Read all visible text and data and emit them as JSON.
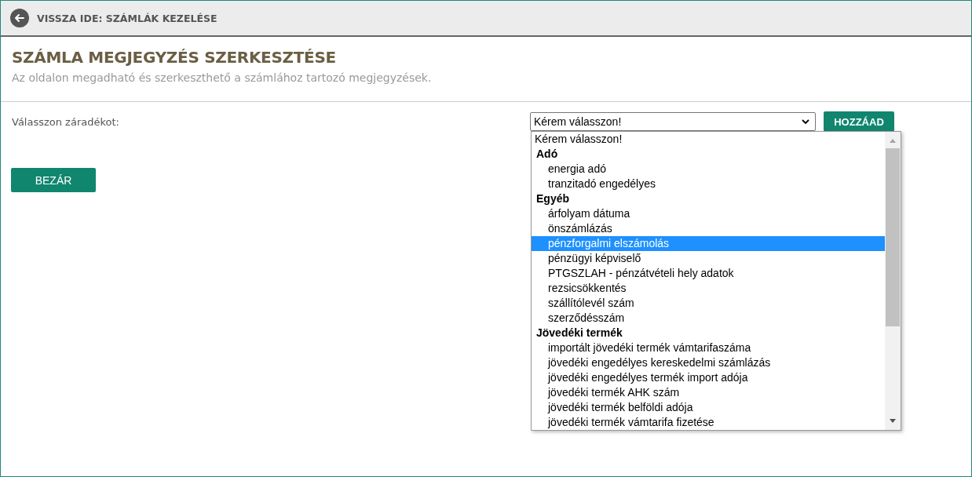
{
  "header": {
    "back_link": "VISSZA IDE: SZÁMLÁK KEZELÉSE"
  },
  "page": {
    "title": "SZÁMLA MEGJEGYZÉS SZERKESZTÉSE",
    "subtitle": "Az oldalon megadható és szerkeszthető a számlához tartozó megjegyzések."
  },
  "form": {
    "label": "Válasszon záradékot:",
    "select_value": "Kérem válasszon!",
    "add_button": "HOZZÁAD",
    "close_button": "BEZÁR"
  },
  "dropdown": {
    "items": [
      {
        "kind": "option",
        "label": "Kérem válasszon!",
        "selected": false
      },
      {
        "kind": "group",
        "label": "Adó",
        "children": [
          {
            "label": "energia adó",
            "selected": false
          },
          {
            "label": "tranzitadó engedélyes",
            "selected": false
          }
        ]
      },
      {
        "kind": "group",
        "label": "Egyéb",
        "children": [
          {
            "label": "árfolyam dátuma",
            "selected": false
          },
          {
            "label": "önszámlázás",
            "selected": false
          },
          {
            "label": "pénzforgalmi elszámolás",
            "selected": true
          },
          {
            "label": "pénzügyi képviselő",
            "selected": false
          },
          {
            "label": "PTGSZLAH - pénzátvételi hely adatok",
            "selected": false
          },
          {
            "label": "rezsicsökkentés",
            "selected": false
          },
          {
            "label": "szállítólevél szám",
            "selected": false
          },
          {
            "label": "szerződésszám",
            "selected": false
          }
        ]
      },
      {
        "kind": "group",
        "label": "Jövedéki termék",
        "children": [
          {
            "label": "importált jövedéki termék vámtarifaszáma",
            "selected": false
          },
          {
            "label": "jövedéki engedélyes kereskedelmi számlázás",
            "selected": false
          },
          {
            "label": "jövedéki engedélyes termék import adója",
            "selected": false
          },
          {
            "label": "jövedéki termék AHK szám",
            "selected": false
          },
          {
            "label": "jövedéki termék belföldi adója",
            "selected": false
          },
          {
            "label": "jövedéki termék vámtarifa fizetése",
            "selected": false
          }
        ]
      }
    ]
  }
}
